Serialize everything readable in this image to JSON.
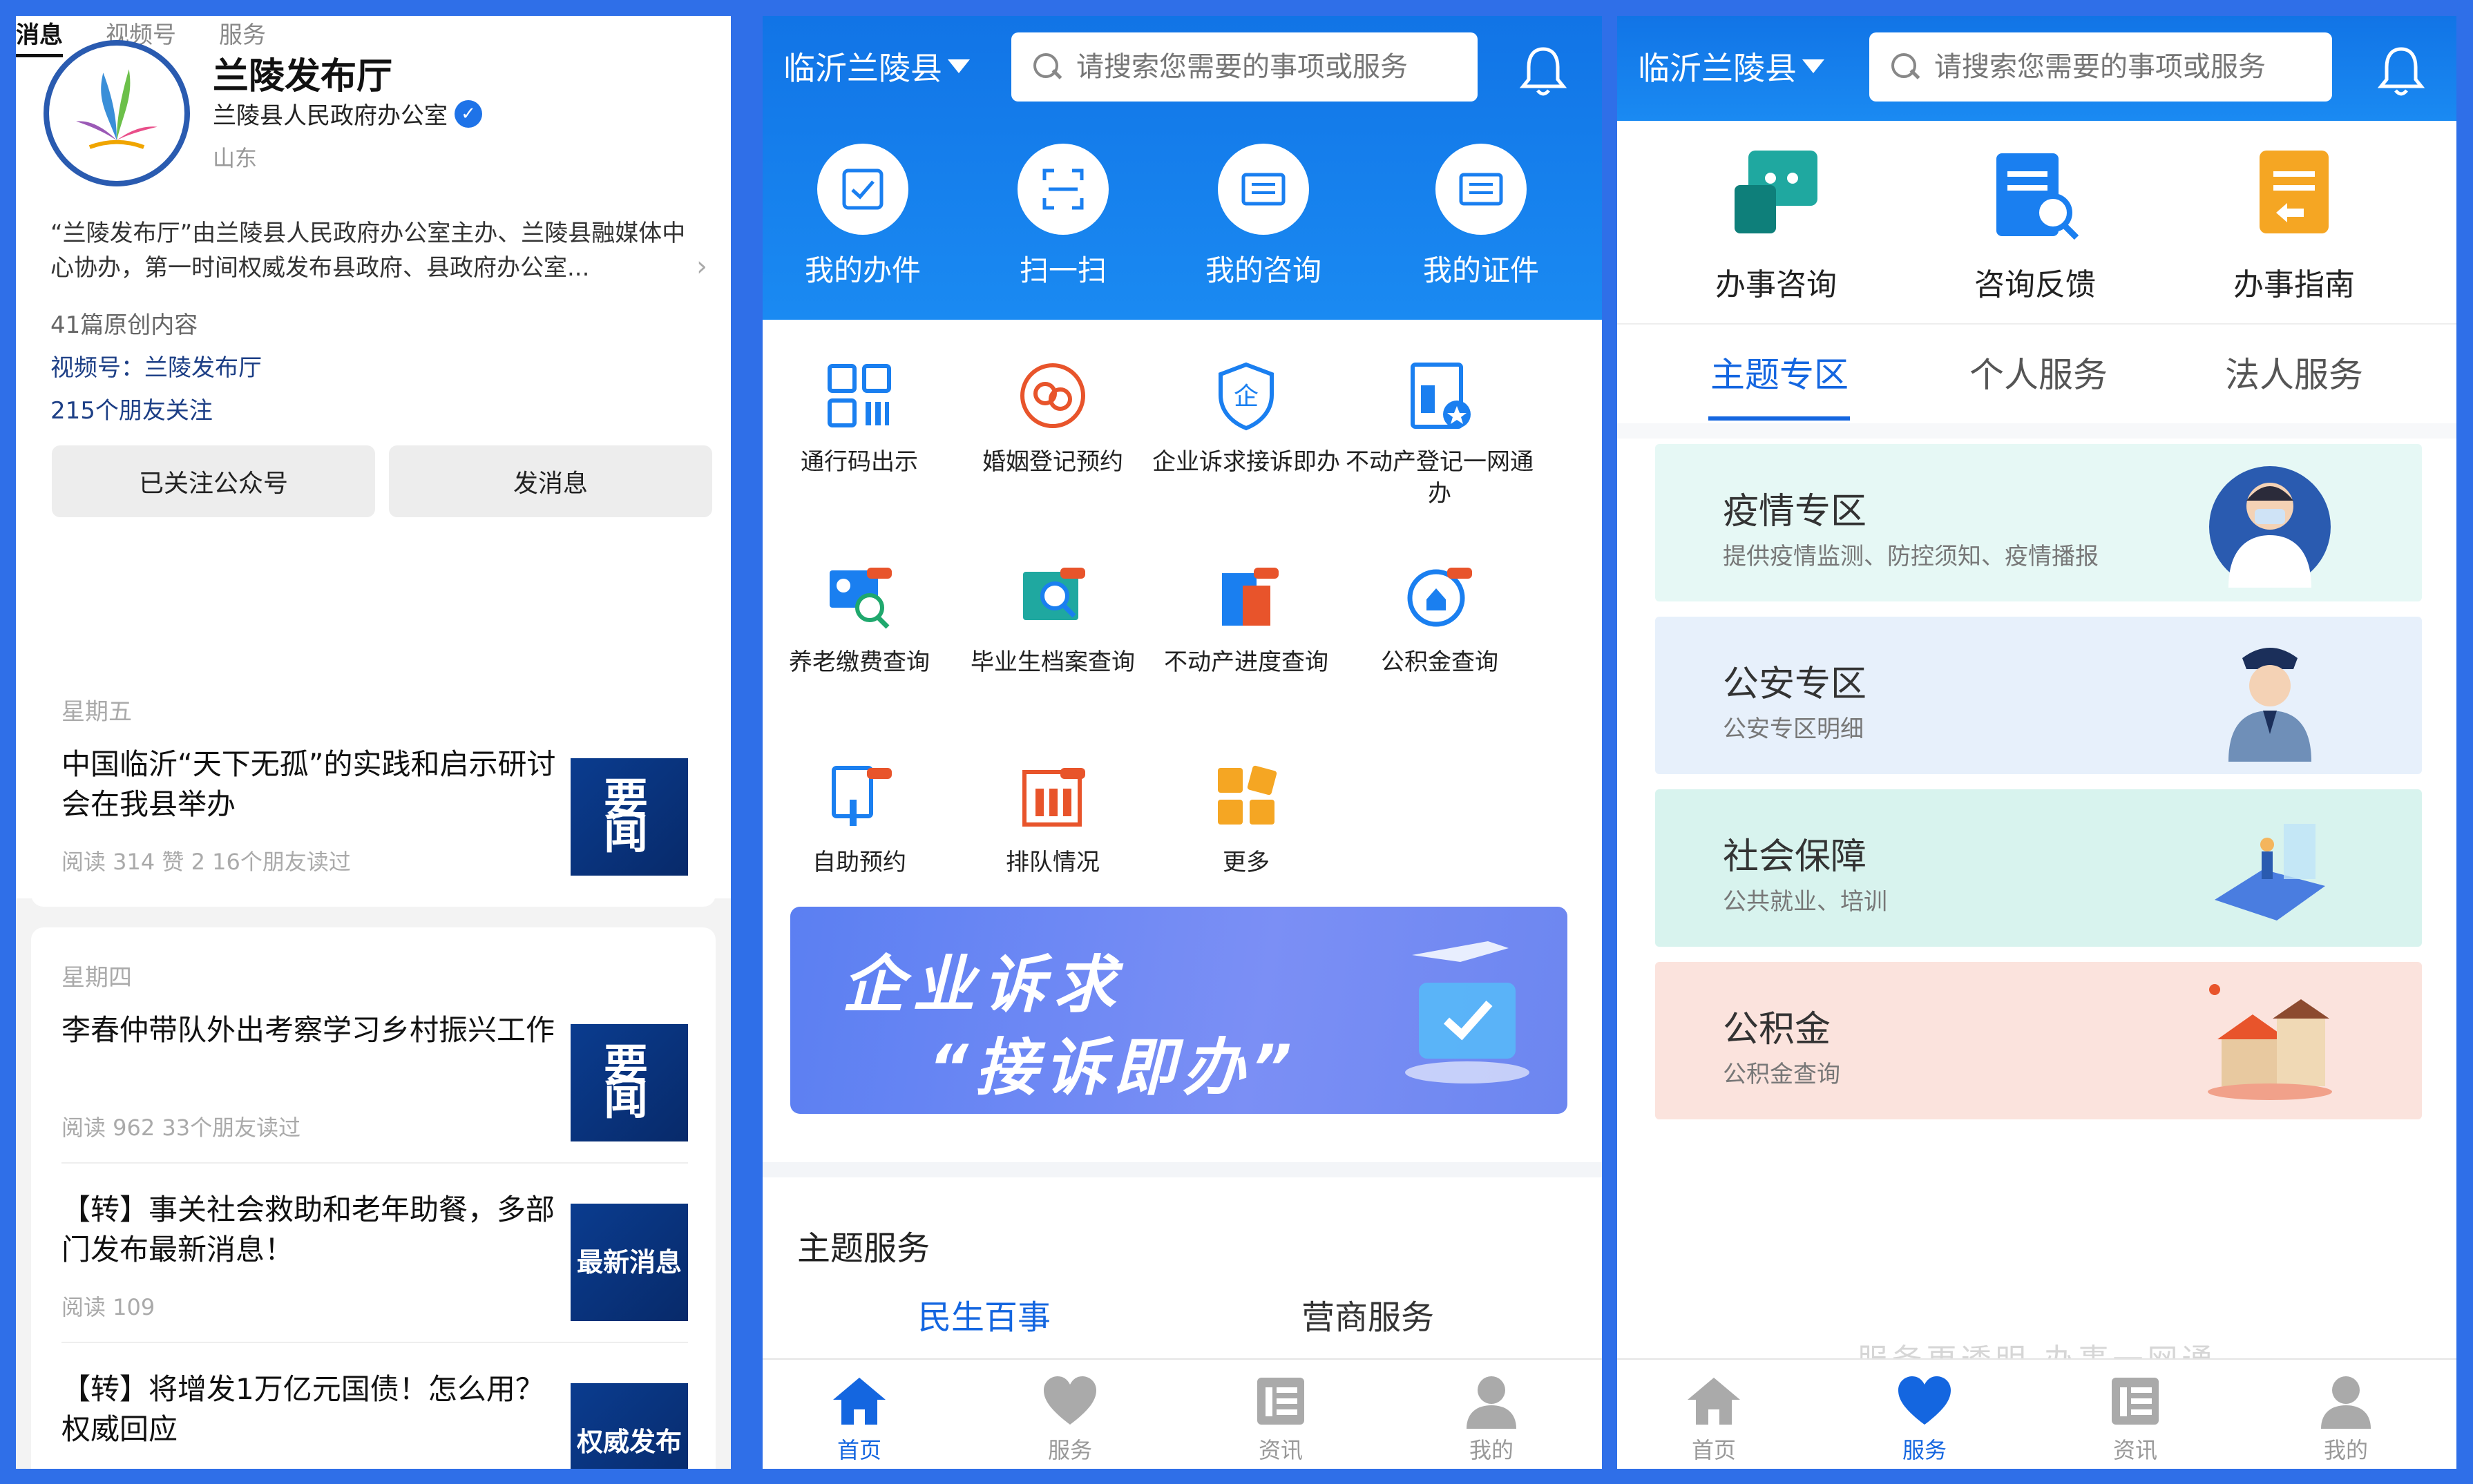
{
  "panel1": {
    "account_name": "兰陵发布厅",
    "org": "兰陵县人民政府办公室",
    "region": "山东",
    "description": "“兰陵发布厅”由兰陵县人民政府办公室主办、兰陵县融媒体中心协办，第一时间权威发布县政府、县政府办公室...",
    "original_count": "41篇原创内容",
    "video_account": "视频号：兰陵发布厅",
    "friends_follow": "215个朋友关注",
    "btn_followed": "已关注公众号",
    "btn_message": "发消息",
    "tabs": [
      "消息",
      "视频号",
      "服务"
    ],
    "groups": [
      {
        "day": "星期五",
        "articles": [
          {
            "title": "中国临沂“天下无孤”的实践和启示研讨会在我县举办",
            "meta": "阅读 314   赞 2   16个朋友读过",
            "thumb": "要 闻"
          }
        ]
      },
      {
        "day": "星期四",
        "articles": [
          {
            "title": "李春仲带队外出考察学习乡村振兴工作",
            "meta": "阅读 962   33个朋友读过",
            "thumb": "要 闻"
          },
          {
            "title": "【转】事关社会救助和老年助餐，多部门发布最新消息！",
            "meta": "阅读 109",
            "thumb": "最新消息"
          },
          {
            "title": "【转】将增发1万亿元国债！怎么用？权威回应",
            "meta": "",
            "thumb": "权威发布"
          }
        ]
      }
    ]
  },
  "panel2": {
    "city": "临沂兰陵县",
    "search_placeholder": "请搜索您需要的事项或服务",
    "quick": [
      "我的办件",
      "扫一扫",
      "我的咨询",
      "我的证件"
    ],
    "grid": [
      "通行码出示",
      "婚姻登记预约",
      "企业诉求接诉即办",
      "不动产登记一网通办",
      "养老缴费查询",
      "毕业生档案查询",
      "不动产进度查询",
      "公积金查询",
      "自助预约",
      "排队情况",
      "更多"
    ],
    "banner_line1": "企业诉求",
    "banner_line2": "“接诉即办”",
    "section_title": "主题服务",
    "subtabs": [
      "民生百事",
      "营商服务"
    ],
    "nav": [
      "首页",
      "服务",
      "资讯",
      "我的"
    ]
  },
  "panel3": {
    "city": "临沂兰陵县",
    "search_placeholder": "请搜索您需要的事项或服务",
    "services": [
      "办事咨询",
      "咨询反馈",
      "办事指南"
    ],
    "tabs": [
      "主题专区",
      "个人服务",
      "法人服务"
    ],
    "zones": [
      {
        "title": "疫情专区",
        "desc": "提供疫情监测、防控须知、疫情播报",
        "color": "#e6f8f5"
      },
      {
        "title": "公安专区",
        "desc": "公安专区明细",
        "color": "#e7f0fb"
      },
      {
        "title": "社会保障",
        "desc": "公共就业、培训",
        "color": "#d8f3ee"
      },
      {
        "title": "公积金",
        "desc": "公积金查询",
        "color": "#fbe3dd"
      }
    ],
    "watermark": "服务更透明  办事一网通",
    "nav": [
      "首页",
      "服务",
      "资讯",
      "我的"
    ]
  },
  "colors": {
    "frame": "#2f6fe8",
    "header_blue": "#1a7ff0",
    "active_blue": "#1466e0",
    "orange": "#f5a623"
  }
}
